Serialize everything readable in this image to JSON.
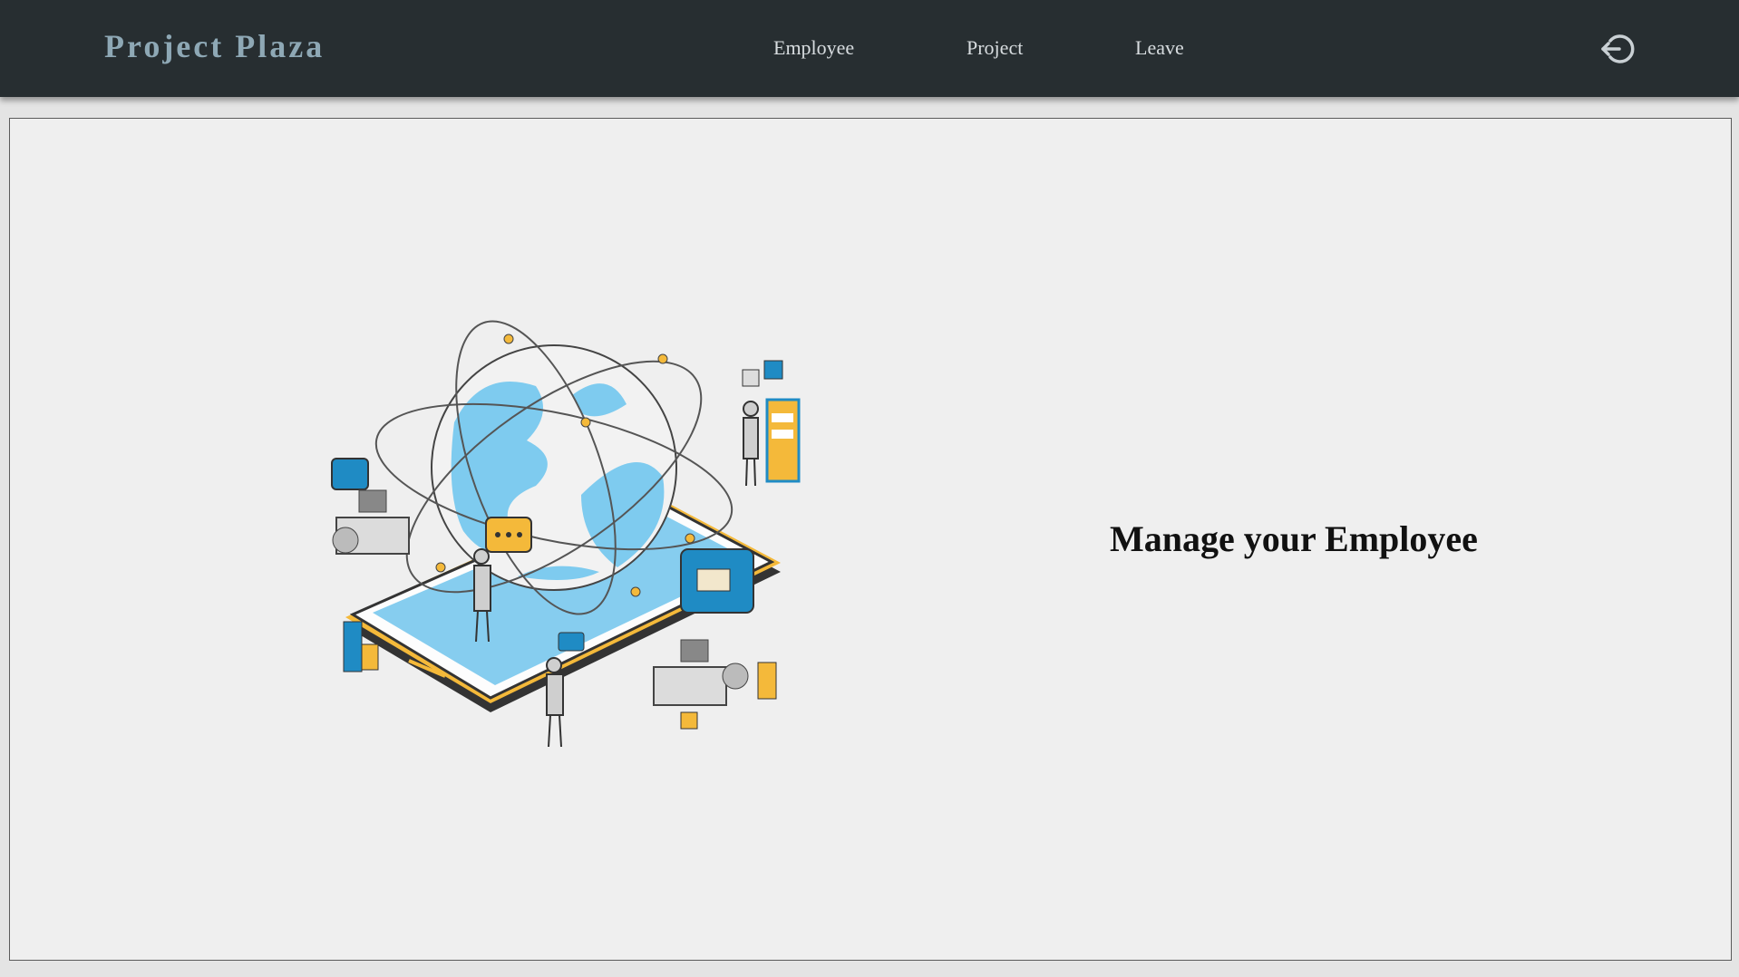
{
  "navbar": {
    "brand": "Project Plaza",
    "links": [
      {
        "label": "Employee"
      },
      {
        "label": "Project"
      },
      {
        "label": "Leave"
      }
    ],
    "logout_icon": "logout-icon"
  },
  "main": {
    "headline": "Manage your Employee",
    "illustration_icon": "isometric-globe-phone-illustration"
  },
  "colors": {
    "navbar_bg": "#272e31",
    "brand": "#8ea8b5",
    "panel_bg": "#efefef",
    "accent_blue": "#7ecbef",
    "accent_yellow": "#f4b93a"
  }
}
